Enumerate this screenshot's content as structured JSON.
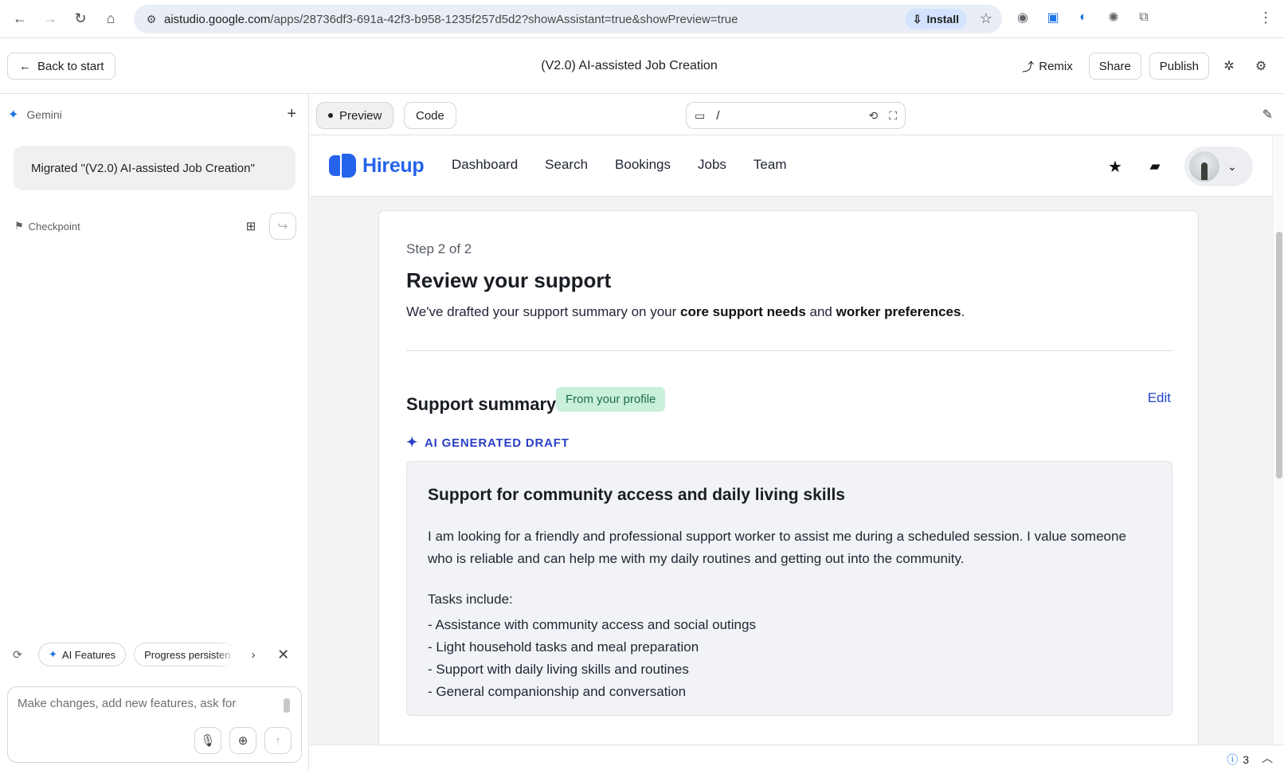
{
  "browser": {
    "url_host": "aistudio.google.com",
    "url_path": "/apps/28736df3-691a-42f3-b958-1235f257d5d2?showAssistant=true&showPreview=true",
    "install_label": "Install"
  },
  "header": {
    "back_label": "Back to start",
    "title": "(V2.0) AI-assisted Job Creation",
    "remix_label": "Remix",
    "share_label": "Share",
    "publish_label": "Publish"
  },
  "left_panel": {
    "gemini_label": "Gemini",
    "migrated_message": "Migrated \"(V2.0) AI-assisted Job Creation\"",
    "checkpoint_label": "Checkpoint",
    "chips": [
      "AI Features",
      "Progress persisten"
    ],
    "prompt_placeholder": "Make changes, add new features, ask for"
  },
  "preview_toolbar": {
    "preview_label": "Preview",
    "code_label": "Code",
    "route": "/"
  },
  "app": {
    "brand": "Hireup",
    "nav": [
      "Dashboard",
      "Search",
      "Bookings",
      "Jobs",
      "Team"
    ],
    "step": "Step 2 of 2",
    "title": "Review your support",
    "intro_pre": "We've drafted your support summary on your ",
    "intro_bold1": "core support needs",
    "intro_mid": " and ",
    "intro_bold2": "worker preferences",
    "intro_post": ".",
    "section_title": "Support summary",
    "profile_badge": "From your profile",
    "edit_label": "Edit",
    "ai_tag": "AI GENERATED DRAFT",
    "draft_title": "Support for community access and daily living skills",
    "draft_body": "I am looking for a friendly and professional support worker to assist me during a scheduled session. I value someone who is reliable and can help me with my daily routines and getting out into the community.",
    "tasks_heading": "Tasks include:",
    "tasks": [
      "- Assistance with community access and social outings",
      "- Light household tasks and meal preparation",
      "- Support with daily living skills and routines",
      "- General companionship and conversation"
    ]
  },
  "status": {
    "issues_count": "3"
  },
  "colors": {
    "brand_blue": "#2563eb",
    "badge_green_bg": "#c9f0db",
    "ai_tag_blue": "#2b3fc7",
    "edit_link": "#2443c9"
  },
  "icons": {
    "back": "arrow-left-icon",
    "forward": "arrow-right-icon",
    "reload": "reload-icon",
    "home": "home-icon",
    "gemini": "sparkle-icon",
    "favorite": "star-icon",
    "messages": "chat-icon"
  }
}
